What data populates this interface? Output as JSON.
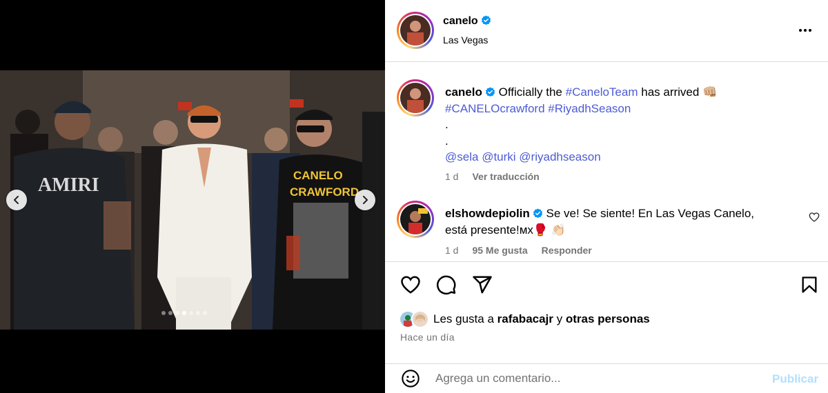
{
  "post": {
    "author": "canelo",
    "location": "Las Vegas",
    "carousel": {
      "total": 7,
      "active_index": 3
    }
  },
  "caption": {
    "author": "canelo",
    "text_prefix": "Officially the ",
    "hashtag1": "#CaneloTeam",
    "text_middle": " has arrived 👊🏼",
    "hashtag2": "#CANELOcrawford",
    "hashtag3": "#RiyadhSeason",
    "dot1": ".",
    "dot2": ".",
    "mention1": "@sela",
    "mention2": "@turki",
    "mention3": "@riyadhseason",
    "time": "1 d",
    "translate": "Ver traducción"
  },
  "comment": {
    "author": "elshowdepiolin",
    "text": "Se ve! Se siente! En Las Vegas Canelo, está presente!мх🥊 👏🏻",
    "time": "1 d",
    "likes": "95 Me gusta",
    "reply": "Responder"
  },
  "likes": {
    "prefix": "Les gusta a ",
    "user": "rafabacajr",
    "joiner": " y ",
    "others": "otras personas"
  },
  "time_ago": "Hace un día",
  "composer": {
    "placeholder": "Agrega un comentario...",
    "publish": "Publicar"
  },
  "colors": {
    "link": "#4c5bd4",
    "verified": "#0095f6",
    "publish_disabled": "#b2dffc",
    "secondary_text": "#737373",
    "divider": "#dbdbdb"
  },
  "icons": [
    "chevron-left-icon",
    "chevron-right-icon",
    "verified-badge-icon",
    "more-horizontal-icon",
    "heart-icon",
    "comment-icon",
    "share-icon",
    "bookmark-icon",
    "emoji-icon"
  ]
}
